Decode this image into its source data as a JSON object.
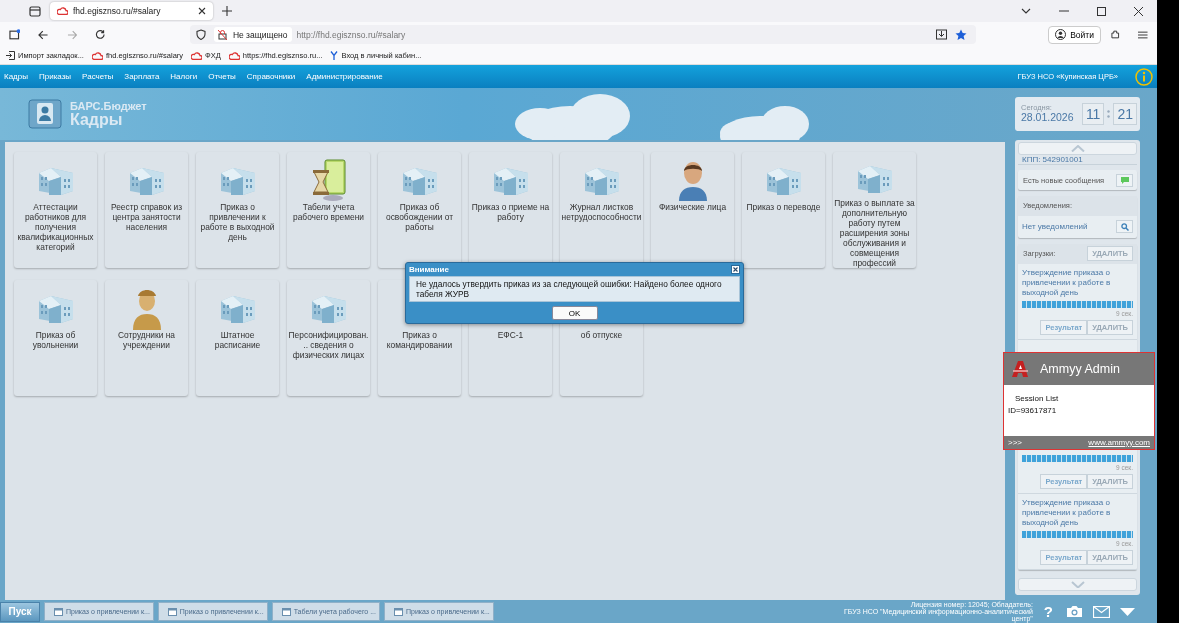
{
  "browser": {
    "tab": {
      "title": "fhd.egisznso.ru/#salary",
      "selected": true
    },
    "security": "Не защищено",
    "url": "http://fhd.egisznso.ru/#salary",
    "login": "Войти",
    "bookmarks": [
      {
        "label": "Импорт закладок...",
        "kind": "import"
      },
      {
        "label": "fhd.egisznso.ru/#salary",
        "kind": "site"
      },
      {
        "label": "ФХД",
        "kind": "site"
      },
      {
        "label": "https://fhd.egisznso.ru...",
        "kind": "site"
      },
      {
        "label": "Вход в личный кабин...",
        "kind": "ya"
      }
    ]
  },
  "menu": {
    "items": [
      "Кадры",
      "Приказы",
      "Расчеты",
      "Зарплата",
      "Налоги",
      "Отчеты",
      "Справочники",
      "Администрирование"
    ],
    "organization": "ГБУЗ НСО «Купинская ЦРБ»"
  },
  "logo": {
    "product": "БАРС.Бюджет",
    "module": "Кадры"
  },
  "tile_rows": [
    {
      "tiles": [
        {
          "label": "Аттестации работников для получения квалификационных категорий",
          "kind": "building"
        },
        {
          "label": "Реестр справок из центра занятости населения",
          "kind": "building"
        },
        {
          "label": "Приказ о привлечении к работе в выходной день",
          "kind": "building"
        },
        {
          "label": "Табели учета рабочего времени",
          "kind": "hourglass"
        },
        {
          "label": "Приказ об освобождении от работы",
          "kind": "building"
        },
        {
          "label": "Приказ о приеме на работу",
          "kind": "building"
        },
        {
          "label": "Журнал листков нетрудоспособности",
          "kind": "building"
        },
        {
          "label": "Физические лица",
          "kind": "person"
        },
        {
          "label": "Приказ о переводе",
          "kind": "building"
        },
        {
          "label": "Приказ о выплате за дополнительную работу путем расширения зоны обслуживания и совмещения профессий",
          "kind": "building"
        }
      ]
    },
    {
      "tiles": [
        {
          "label": "Приказ об увольнении",
          "kind": "building"
        },
        {
          "label": "Сотрудники на учреждении",
          "kind": "worker"
        },
        {
          "label": "Штатное расписание",
          "kind": "building"
        },
        {
          "label": "Персонифицирован... сведения о физических лицах",
          "kind": "building"
        },
        {
          "label": "Приказ о командировании"
        },
        {
          "label": "ЕФС-1"
        },
        {
          "label": "об отпуске"
        }
      ]
    }
  ],
  "clock": {
    "label": "Сегодня:",
    "date": "28.01.2026",
    "hours": "11",
    "minutes": "21"
  },
  "side_panel": {
    "kpp": "КПП: 542901001",
    "messages": "Есть новые сообщения",
    "notifications": {
      "title": "Уведомления:",
      "text": "Нет уведомлений"
    },
    "downloads": {
      "title": "Загрузки:",
      "delete": "УДАЛИТЬ",
      "items": [
        {
          "title": "Утверждение приказа о привлечении к работе в выходной день",
          "level": 1,
          "time": "9 сек.",
          "result": "Результат",
          "delete": "УДАЛИТЬ"
        },
        {
          "level": 1,
          "time": "9 сек.",
          "result": "Результат",
          "delete": "УДАЛИТЬ"
        },
        {
          "title": "Утверждение приказа о привлечении к работе в выходной день",
          "level": 1,
          "time": "9 сек.",
          "result": "Результат",
          "delete": "УДАЛИТЬ"
        }
      ]
    }
  },
  "dialog": {
    "title": "Внимание",
    "message": "Не удалось утвердить приказ из за следующей ошибки: Найдено более одного табеля ЖУРВ",
    "ok": "OK"
  },
  "ammyy": {
    "title": "Ammyy Admin",
    "session": "Session List",
    "id": "ID=93617871",
    "more": ">>>",
    "link": "www.ammyy.com"
  },
  "taskbar": {
    "start": "Пуск",
    "tasks": [
      "Приказ о привлечении к...",
      "Приказ о привлечении к...",
      "Табели учета рабочего ...",
      "Приказ о привлечении к..."
    ],
    "license": [
      "Лицензия номер: 12045; Обладатель:",
      "ГБУЗ НСО \"Медицинский информационно-аналитический",
      "центр\""
    ],
    "help": "?"
  }
}
